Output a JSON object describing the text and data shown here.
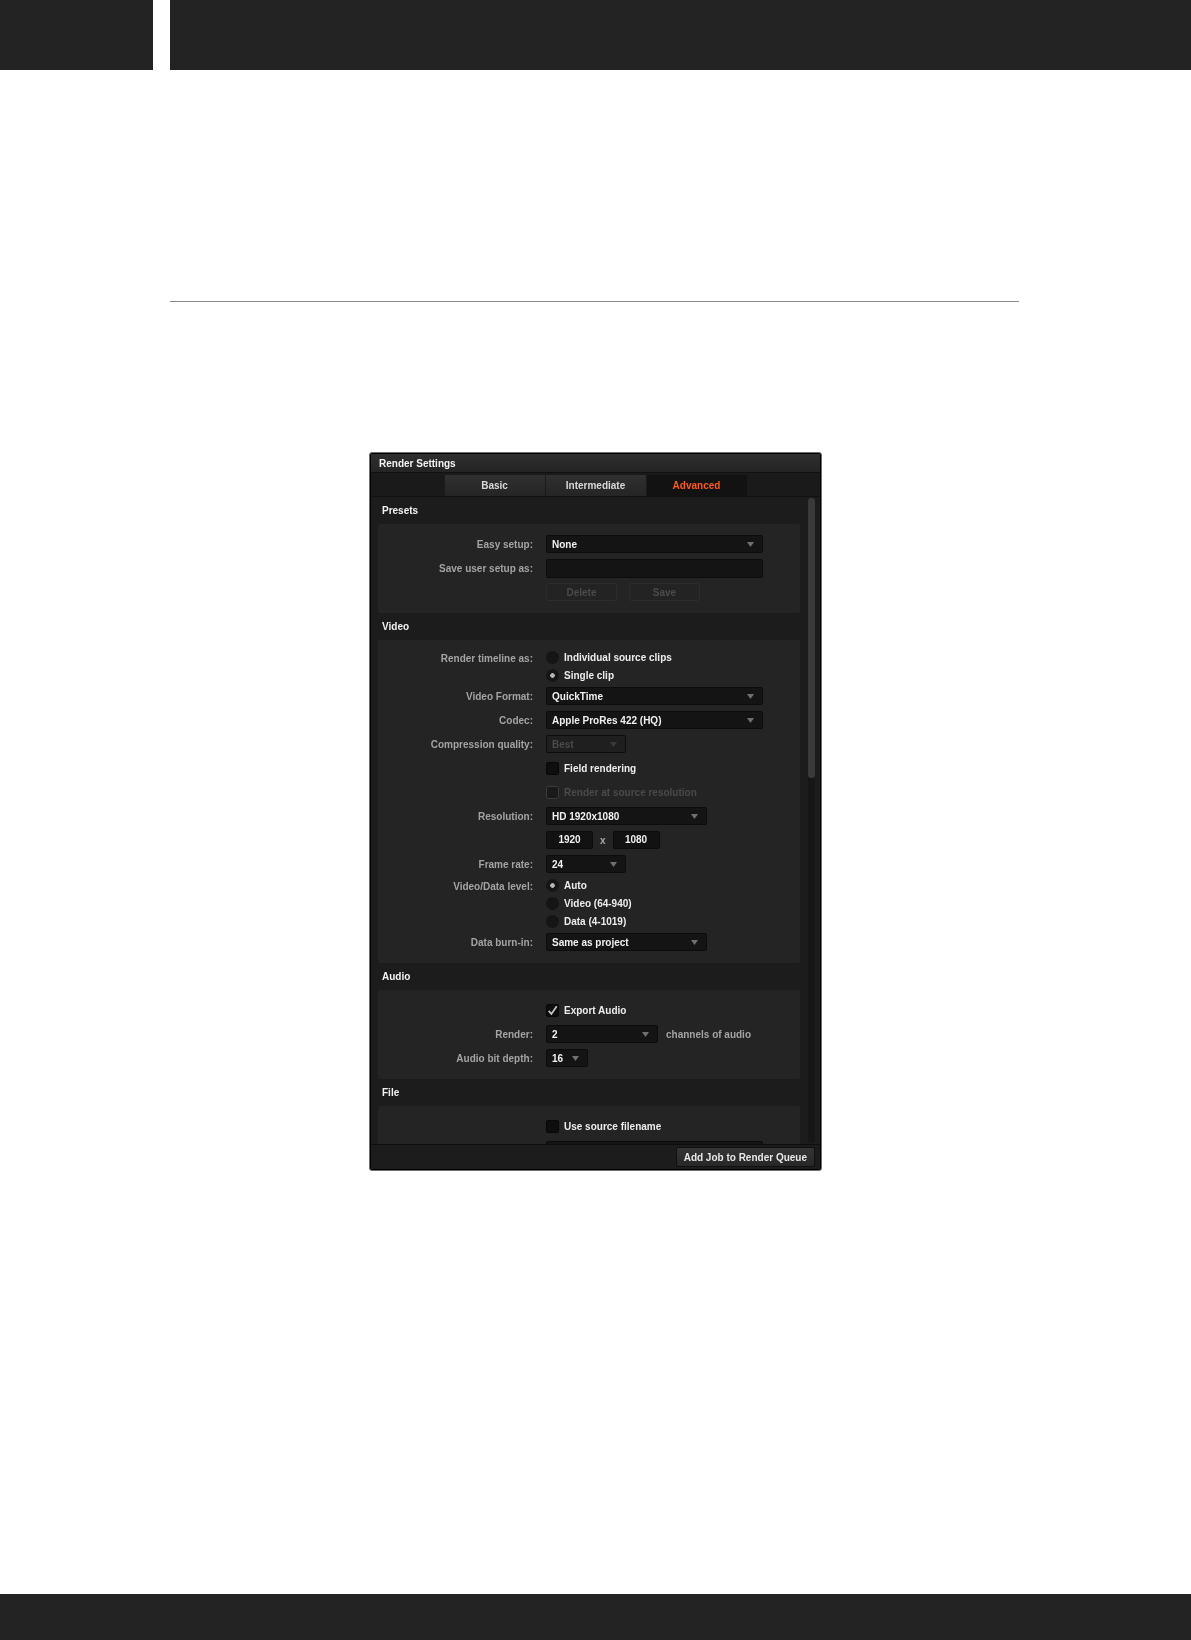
{
  "window": {
    "title": "Render Settings"
  },
  "tabs": [
    {
      "label": "Basic",
      "selected": false
    },
    {
      "label": "Intermediate",
      "selected": false
    },
    {
      "label": "Advanced",
      "selected": true
    }
  ],
  "sections": [
    {
      "title": "Presets",
      "rows": [
        {
          "kind": "dropdown",
          "label": "Easy setup:",
          "value": "None",
          "disabled": false
        },
        {
          "kind": "text_field",
          "label": "Save user setup as:"
        },
        {
          "kind": "buttons",
          "buttons": [
            {
              "label": "Delete",
              "disabled": true
            },
            {
              "label": "Save",
              "disabled": true
            }
          ]
        }
      ]
    },
    {
      "title": "Video",
      "rows": [
        {
          "kind": "radio_group",
          "label": "Render timeline as:",
          "options": [
            {
              "label": "Individual source clips",
              "selected": false
            },
            {
              "label": "Single clip",
              "selected": true
            }
          ]
        },
        {
          "kind": "dropdown",
          "label": "Video Format:",
          "value": "QuickTime",
          "disabled": false
        },
        {
          "kind": "dropdown",
          "label": "Codec:",
          "value": "Apple ProRes 422 (HQ)",
          "disabled": false
        },
        {
          "kind": "dropdown",
          "label": "Compression quality:",
          "value": "Best",
          "disabled": true
        },
        {
          "kind": "checkbox",
          "label": "Field rendering",
          "checked": false,
          "disabled": false
        },
        {
          "kind": "checkbox",
          "label": "Render at source resolution",
          "checked": false,
          "disabled": true
        },
        {
          "kind": "dropdown",
          "label": "Resolution:",
          "value": "HD 1920x1080",
          "disabled": false
        },
        {
          "kind": "size_fields",
          "fields": [
            "1920",
            "1080"
          ],
          "separator": "x"
        },
        {
          "kind": "dropdown",
          "label": "Frame rate:",
          "value": "24",
          "disabled": false
        },
        {
          "kind": "radio_group",
          "label": "Video/Data level:",
          "options": [
            {
              "label": "Auto",
              "selected": true
            },
            {
              "label": "Video (64-940)",
              "selected": false
            },
            {
              "label": "Data (4-1019)",
              "selected": false
            }
          ]
        },
        {
          "kind": "dropdown",
          "label": "Data burn-in:",
          "value": "Same as project",
          "disabled": false
        }
      ]
    },
    {
      "title": "Audio",
      "rows": [
        {
          "kind": "checkbox",
          "label": "Export Audio",
          "checked": true,
          "disabled": false
        },
        {
          "kind": "dropdown",
          "label": "Render:",
          "value": "2",
          "suffix": "channels of audio",
          "disabled": false
        },
        {
          "kind": "dropdown",
          "label": "Audio bit depth:",
          "value": "16",
          "disabled": false
        }
      ]
    },
    {
      "title": "File",
      "rows": [
        {
          "kind": "checkbox",
          "label": "Use source filename",
          "checked": false,
          "disabled": false
        },
        {
          "kind": "text_field"
        }
      ]
    }
  ],
  "footer_button": "Add Job to Render Queue"
}
